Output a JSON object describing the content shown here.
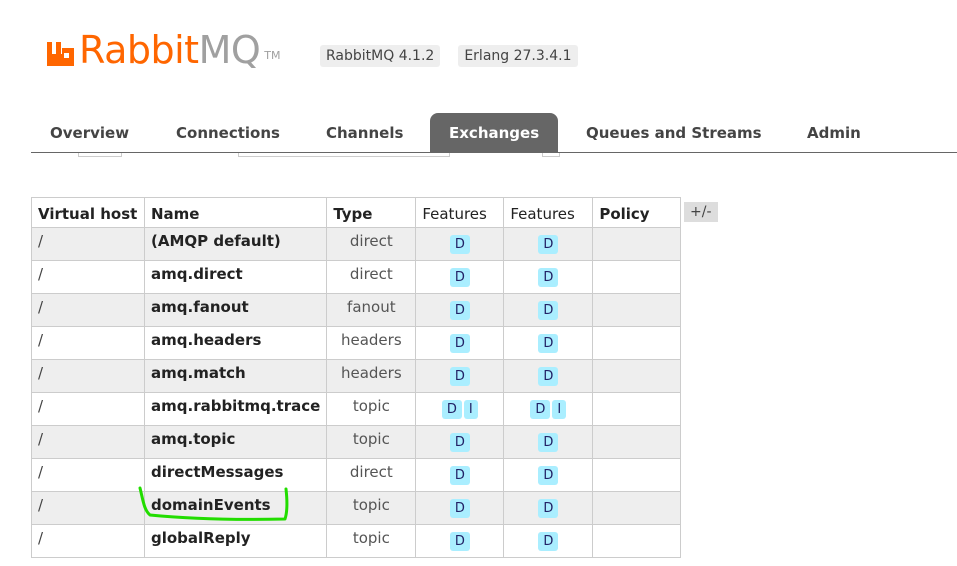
{
  "header": {
    "logo": {
      "rabbit": "Rabbit",
      "mq": "MQ",
      "tm": "TM"
    },
    "versions": [
      "RabbitMQ 4.1.2",
      "Erlang 27.3.4.1"
    ]
  },
  "tabs": [
    {
      "label": "Overview",
      "active": false
    },
    {
      "label": "Connections",
      "active": false
    },
    {
      "label": "Channels",
      "active": false
    },
    {
      "label": "Exchanges",
      "active": true
    },
    {
      "label": "Queues and Streams",
      "active": false
    },
    {
      "label": "Admin",
      "active": false
    }
  ],
  "table": {
    "headers": [
      "Virtual host",
      "Name",
      "Type",
      "Features",
      "Features",
      "Policy"
    ],
    "toggle_columns_label": "+/-",
    "rows": [
      {
        "vhost": "/",
        "name": "(AMQP default)",
        "type": "direct",
        "features1": [
          "D"
        ],
        "features2": [
          "D"
        ],
        "policy": ""
      },
      {
        "vhost": "/",
        "name": "amq.direct",
        "type": "direct",
        "features1": [
          "D"
        ],
        "features2": [
          "D"
        ],
        "policy": ""
      },
      {
        "vhost": "/",
        "name": "amq.fanout",
        "type": "fanout",
        "features1": [
          "D"
        ],
        "features2": [
          "D"
        ],
        "policy": ""
      },
      {
        "vhost": "/",
        "name": "amq.headers",
        "type": "headers",
        "features1": [
          "D"
        ],
        "features2": [
          "D"
        ],
        "policy": ""
      },
      {
        "vhost": "/",
        "name": "amq.match",
        "type": "headers",
        "features1": [
          "D"
        ],
        "features2": [
          "D"
        ],
        "policy": ""
      },
      {
        "vhost": "/",
        "name": "amq.rabbitmq.trace",
        "type": "topic",
        "features1": [
          "D",
          "I"
        ],
        "features2": [
          "D",
          "I"
        ],
        "policy": ""
      },
      {
        "vhost": "/",
        "name": "amq.topic",
        "type": "topic",
        "features1": [
          "D"
        ],
        "features2": [
          "D"
        ],
        "policy": ""
      },
      {
        "vhost": "/",
        "name": "directMessages",
        "type": "direct",
        "features1": [
          "D"
        ],
        "features2": [
          "D"
        ],
        "policy": ""
      },
      {
        "vhost": "/",
        "name": "domainEvents",
        "type": "topic",
        "features1": [
          "D"
        ],
        "features2": [
          "D"
        ],
        "policy": ""
      },
      {
        "vhost": "/",
        "name": "globalReply",
        "type": "topic",
        "features1": [
          "D"
        ],
        "features2": [
          "D"
        ],
        "policy": ""
      }
    ]
  },
  "colors": {
    "brand_orange": "#ff6600",
    "tab_active_bg": "#666666",
    "feature_badge": "#aaeeff",
    "annotation_green": "#22dd00"
  },
  "icons": [
    "rabbitmq-logo-icon"
  ]
}
